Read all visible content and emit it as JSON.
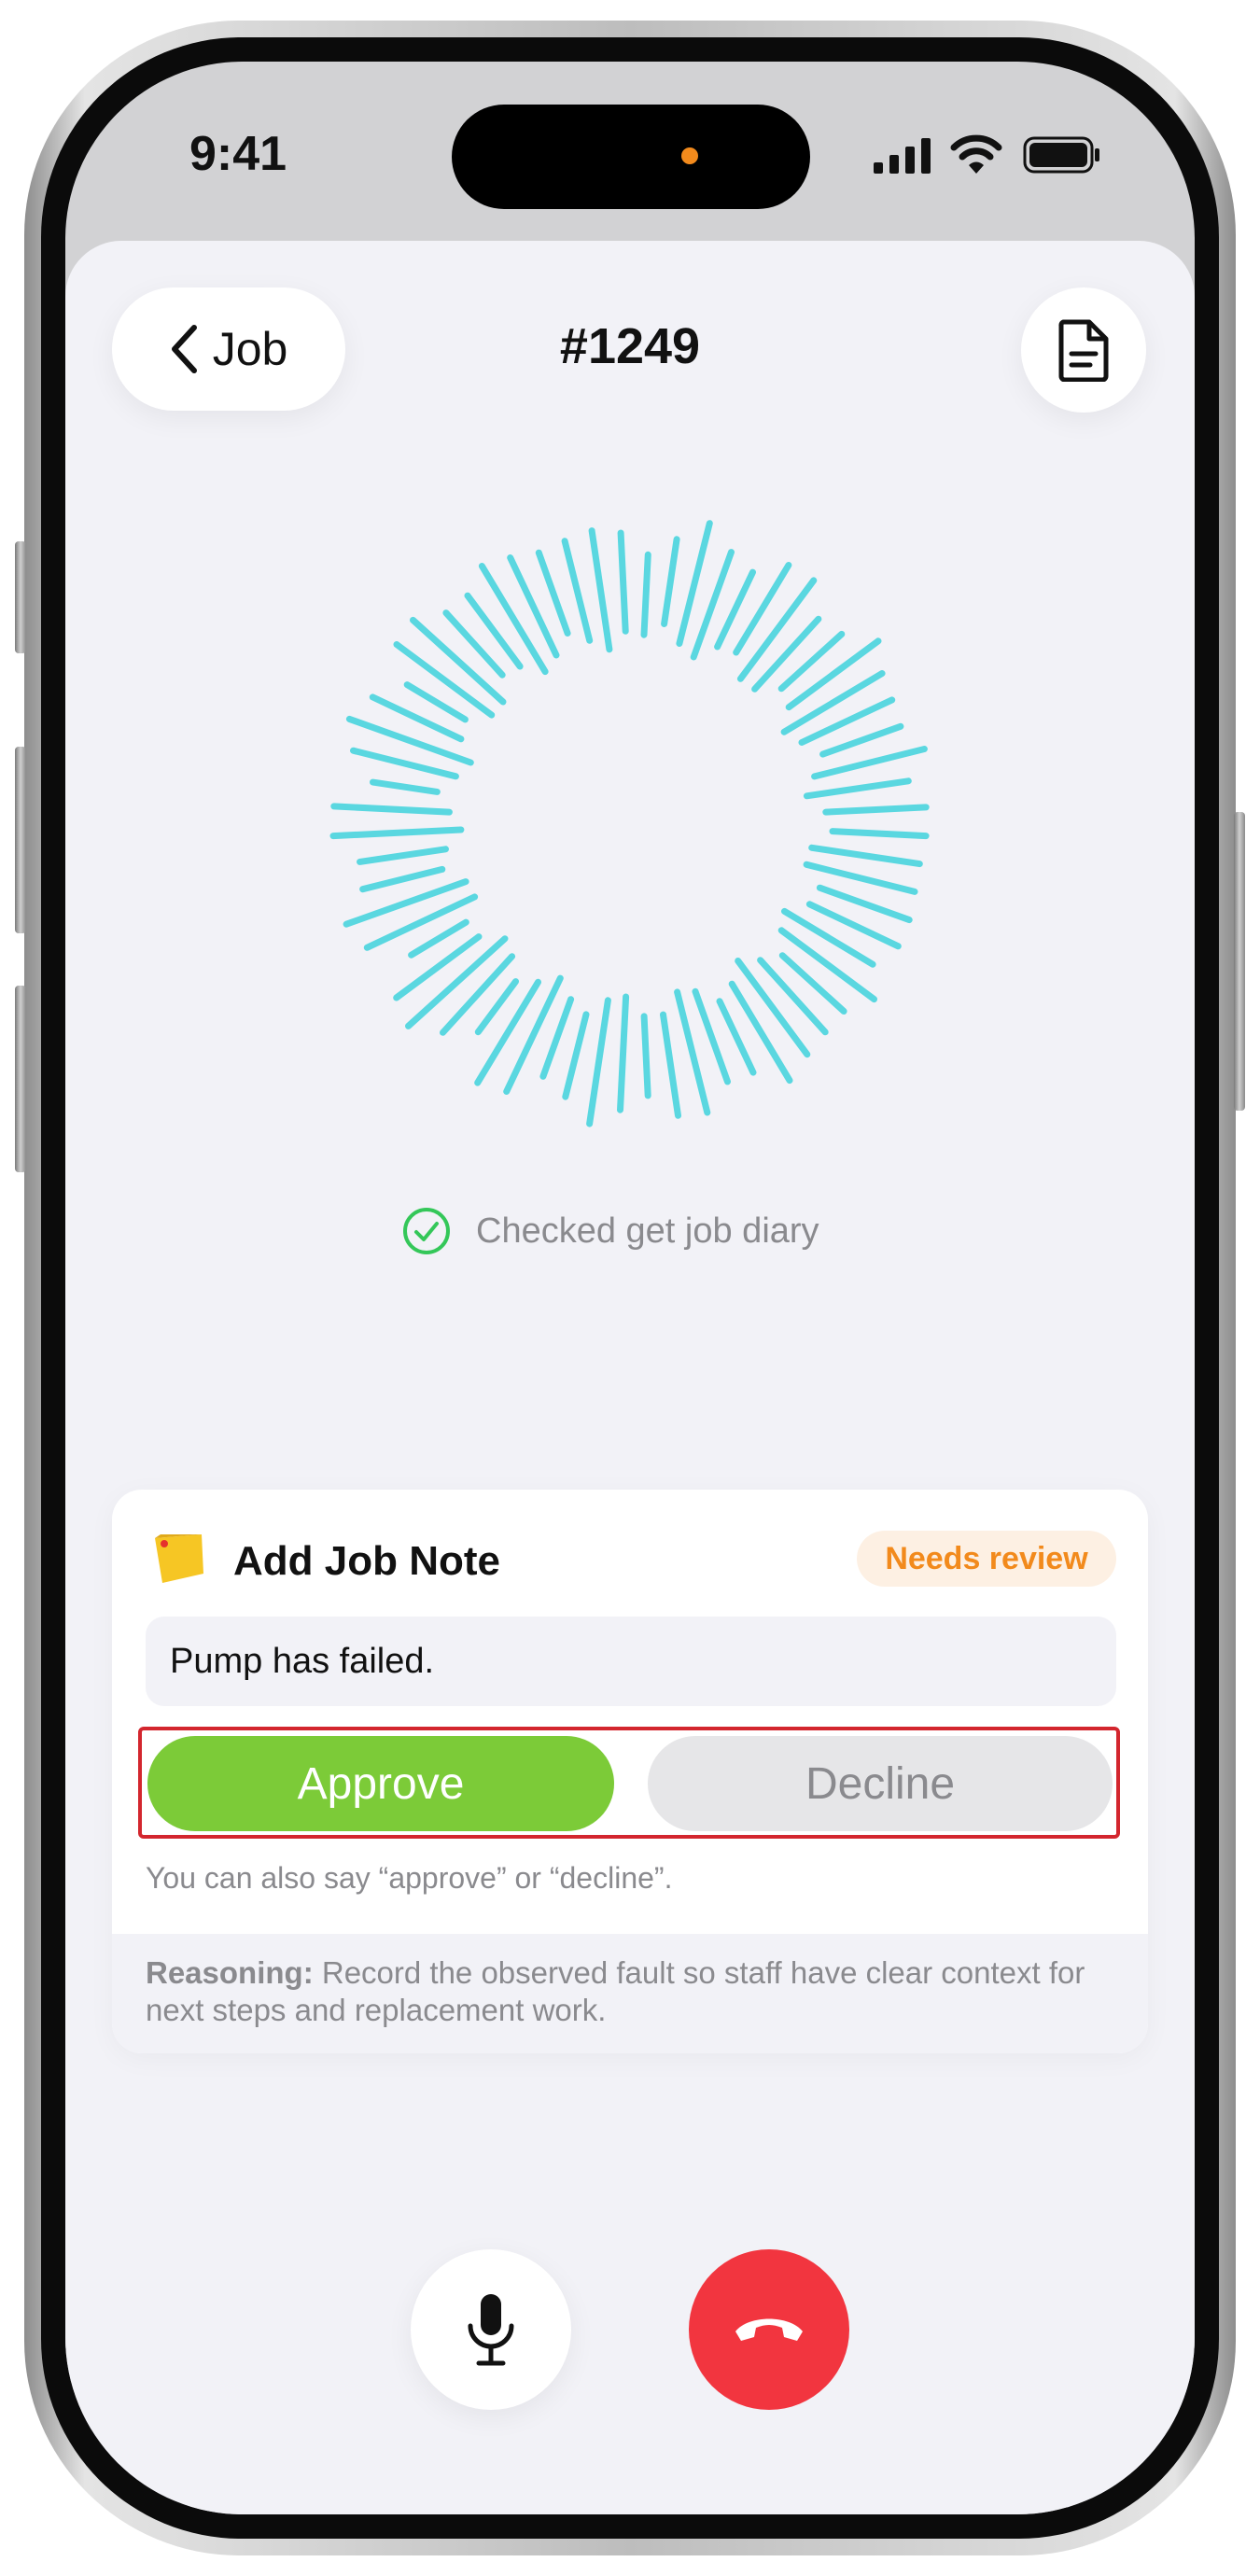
{
  "status_bar": {
    "time": "9:41"
  },
  "header": {
    "back_label": "Job",
    "title": "#1249"
  },
  "activity": {
    "status_text": "Checked get job diary",
    "accent_color": "#5ad7e0"
  },
  "card": {
    "title": "Add Job Note",
    "badge": "Needs review",
    "note_text": "Pump has failed.",
    "approve_label": "Approve",
    "decline_label": "Decline",
    "hint": "You can also say “approve” or “decline”.",
    "reasoning_label": "Reasoning:",
    "reasoning_text": " Record the observed fault so staff have clear context for next steps and replacement work."
  },
  "colors": {
    "approve": "#7ccb38",
    "end_call": "#f2353f",
    "badge_text": "#f28a1c",
    "highlight_border": "#d3262e"
  }
}
